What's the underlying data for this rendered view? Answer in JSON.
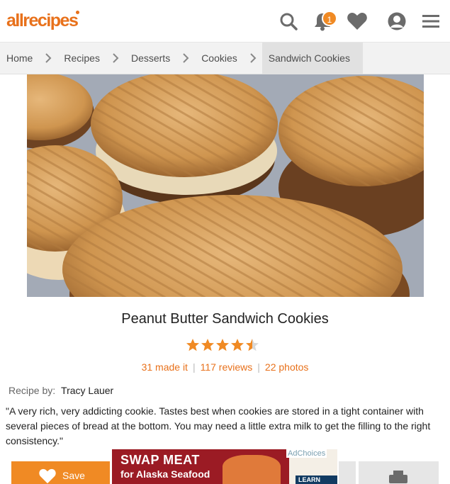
{
  "header": {
    "logo_text": "allrecipes",
    "notification_count": "1",
    "icons": [
      "search-icon",
      "bell-icon",
      "heart-icon",
      "user-icon",
      "menu-icon"
    ],
    "accent_color": "#e8711b"
  },
  "breadcrumb": [
    {
      "label": "Home"
    },
    {
      "label": "Recipes"
    },
    {
      "label": "Desserts"
    },
    {
      "label": "Cookies"
    },
    {
      "label": "Sandwich Cookies"
    }
  ],
  "recipe": {
    "title": "Peanut Butter Sandwich Cookies",
    "rating": 4.5,
    "rating_max": 5,
    "made_it": "31 made it",
    "reviews": "117 reviews",
    "photos": "22 photos",
    "byline_label": "Recipe by:",
    "author": "Tracy Lauer",
    "description": "\"A very rich, very addicting cookie. Tastes best when cookies are stored in a tight container with several pieces of bread at the bottom. You may need a little extra milk to get the filling to the right consistency.\""
  },
  "actions": {
    "save_label": "Save"
  },
  "ad": {
    "line1": "SWAP MEAT",
    "line2": "for Alaska Seafood",
    "adchoices": "AdChoices",
    "cta": "LEARN NOW"
  }
}
